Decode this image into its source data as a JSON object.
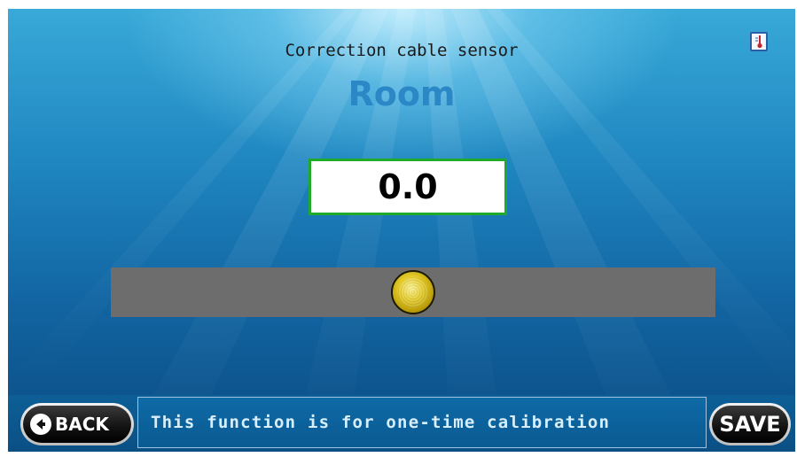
{
  "header": {
    "title": "Correction cable sensor",
    "subtitle": "Room"
  },
  "value_display": {
    "value": "0.0"
  },
  "slider": {
    "level_fraction": 0.5
  },
  "thermometer_button": {
    "icon": "thermometer-icon"
  },
  "footer": {
    "back_label": "BACK",
    "back_icon": "arrow-left-icon",
    "message": "This function is for one-time calibration",
    "save_label": "SAVE"
  },
  "colors": {
    "accent_title": "#2b87c6",
    "value_border": "#1faa2b",
    "slider_track": "#6d6d6d",
    "knob_gold": "#e6cd2a"
  }
}
